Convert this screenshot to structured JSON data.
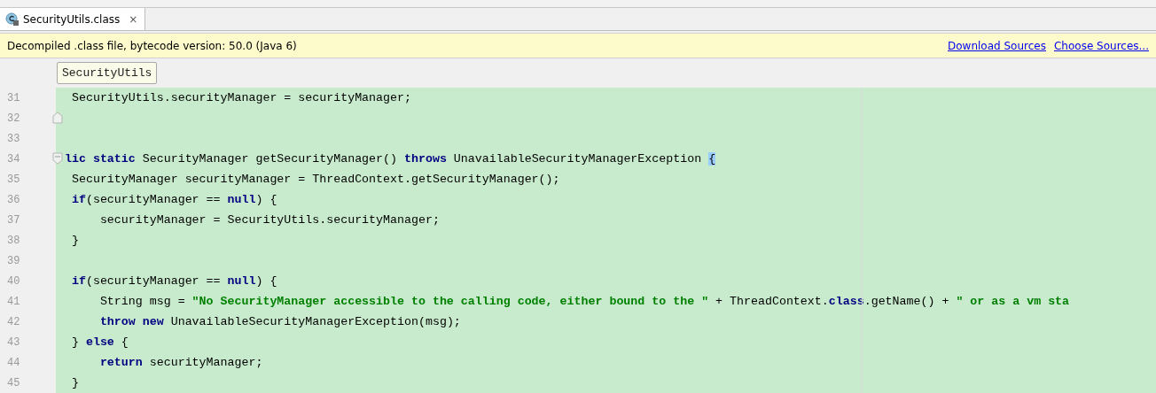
{
  "tabs": [
    {
      "label": "SecurityUtils.class",
      "selected": true,
      "close": "×"
    }
  ],
  "banner": {
    "text": "Decompiled .class file, bytecode version: 50.0 (Java 6)",
    "links": [
      "Download Sources",
      "Choose Sources..."
    ]
  },
  "breadcrumb": "SecurityUtils",
  "lines": [
    {
      "number": "31",
      "tokens": [
        {
          "kind": "plain",
          "text": "  SecurityUtils.securityManager = securityManager;"
        }
      ]
    },
    {
      "number": "32",
      "fold_end": true
    },
    {
      "number": "33"
    },
    {
      "number": "34",
      "fold_start": true,
      "tokens": [
        {
          "kind": "keyword",
          "text": " lic static"
        },
        {
          "kind": "plain",
          "text": " SecurityManager getSecurityManager() "
        },
        {
          "kind": "keyword",
          "text": "throws"
        },
        {
          "kind": "plain",
          "text": " UnavailableSecurityManagerException "
        },
        {
          "kind": "brace_match",
          "text": "{"
        }
      ]
    },
    {
      "number": "35",
      "tokens": [
        {
          "kind": "plain",
          "text": "  SecurityManager securityManager = ThreadContext.getSecurityManager();"
        }
      ]
    },
    {
      "number": "36",
      "tokens": [
        {
          "kind": "keyword",
          "text": "  if"
        },
        {
          "kind": "plain",
          "text": "(securityManager == "
        },
        {
          "kind": "keyword",
          "text": "null"
        },
        {
          "kind": "plain",
          "text": ") {"
        }
      ]
    },
    {
      "number": "37",
      "tokens": [
        {
          "kind": "plain",
          "text": "      securityManager = SecurityUtils.securityManager;"
        }
      ]
    },
    {
      "number": "38",
      "tokens": [
        {
          "kind": "plain",
          "text": "  }"
        }
      ]
    },
    {
      "number": "39"
    },
    {
      "number": "40",
      "tokens": [
        {
          "kind": "keyword",
          "text": "  if"
        },
        {
          "kind": "plain",
          "text": "(securityManager == "
        },
        {
          "kind": "keyword",
          "text": "null"
        },
        {
          "kind": "plain",
          "text": ") {"
        }
      ]
    },
    {
      "number": "41",
      "tokens": [
        {
          "kind": "plain",
          "text": "      String msg = "
        },
        {
          "kind": "string",
          "text": "\"No SecurityManager accessible to the calling code, either bound to the \""
        },
        {
          "kind": "plain",
          "text": " + ThreadContext."
        },
        {
          "kind": "keyword",
          "text": "class"
        },
        {
          "kind": "plain",
          "text": ".getName() + "
        },
        {
          "kind": "string",
          "text": "\" or as a vm sta"
        }
      ]
    },
    {
      "number": "42",
      "tokens": [
        {
          "kind": "keyword",
          "text": "      throw new"
        },
        {
          "kind": "plain",
          "text": " UnavailableSecurityManagerException(msg);"
        }
      ]
    },
    {
      "number": "43",
      "tokens": [
        {
          "kind": "plain",
          "text": "  } "
        },
        {
          "kind": "keyword",
          "text": "else"
        },
        {
          "kind": "plain",
          "text": " {"
        }
      ]
    },
    {
      "number": "44",
      "tokens": [
        {
          "kind": "keyword",
          "text": "      return"
        },
        {
          "kind": "plain",
          "text": " securityManager;"
        }
      ]
    },
    {
      "number": "45",
      "tokens": [
        {
          "kind": "plain",
          "text": "  }"
        }
      ]
    }
  ]
}
